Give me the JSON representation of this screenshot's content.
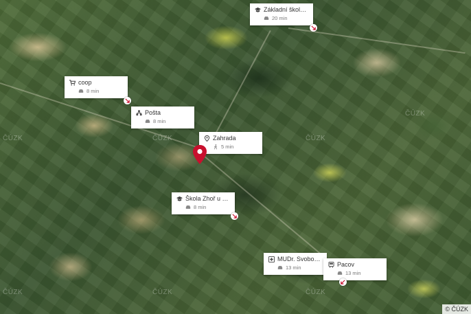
{
  "map": {
    "attribution": "© ČÚZK",
    "watermark": "ČÚZK",
    "accent_color": "#c8102e"
  },
  "pois": [
    {
      "id": "zakladni-skola",
      "icon": "graduation-cap-icon",
      "name": "Základní škola Lu...",
      "mode": "car-icon",
      "time": "20 min"
    },
    {
      "id": "coop",
      "icon": "shopping-cart-icon",
      "name": "coop",
      "mode": "car-icon",
      "time": "8 min"
    },
    {
      "id": "posta",
      "icon": "post-office-icon",
      "name": "Pošta",
      "mode": "car-icon",
      "time": "8 min"
    },
    {
      "id": "zahrada",
      "icon": "location-icon",
      "name": "Zahrada",
      "mode": "walk-icon",
      "time": "5 min"
    },
    {
      "id": "skola-zhor",
      "icon": "graduation-cap-icon",
      "name": "Škola Zhoř u Paco...",
      "mode": "car-icon",
      "time": "8 min"
    },
    {
      "id": "mudr",
      "icon": "medical-cross-icon",
      "name": "MUDr. Svobodová...",
      "mode": "car-icon",
      "time": "13 min"
    },
    {
      "id": "pacov",
      "icon": "train-icon",
      "name": "Pacov",
      "mode": "car-icon",
      "time": "13 min"
    }
  ]
}
